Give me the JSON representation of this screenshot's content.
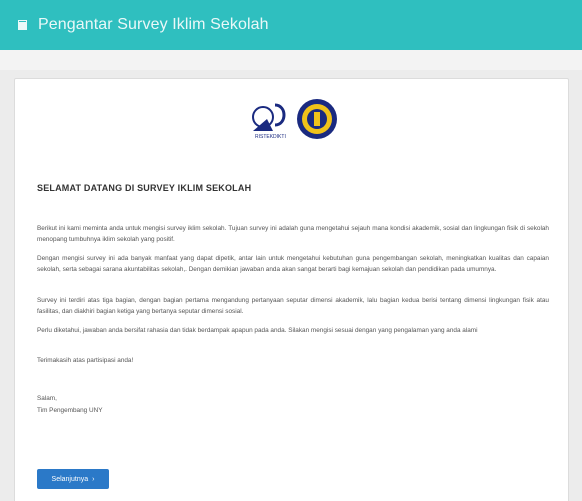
{
  "header": {
    "title": "Pengantar Survey Iklim Sekolah",
    "icon": "book-icon"
  },
  "logos": {
    "left": {
      "name": "ristekdikti-logo",
      "text": "RISTEKDIKTI"
    },
    "right": {
      "name": "uny-logo"
    }
  },
  "content": {
    "heading": "SELAMAT DATANG DI SURVEY IKLIM SEKOLAH",
    "paragraphs": [
      "Berikut ini kami meminta anda untuk mengisi survey iklim sekolah. Tujuan survey ini adalah guna mengetahui sejauh mana kondisi akademik, sosial dan lingkungan fisik di sekolah menopang tumbuhnya iklim sekolah yang positif.",
      "Dengan mengisi survey ini ada banyak manfaat yang dapat dipetik, antar lain untuk mengetahui kebutuhan guna pengembangan sekolah, meningkatkan kualitas dan capaian sekolah, serta sebagai sarana akuntabilitas sekolah,. Dengan demikian jawaban anda akan sangat berarti bagi kemajuan sekolah dan pendidikan pada umumnya.",
      "Survey ini terdiri atas tiga bagian, dengan bagian pertama mengandung pertanyaan seputar dimensi akademik, lalu bagian kedua berisi tentang dimensi lingkungan fisik atau fasilitas, dan diakhiri bagian ketiga yang bertanya seputar dimensi sosial.",
      "Perlu diketahui, jawaban anda bersifat rahasia dan tidak berdampak apapun pada anda. Silakan mengisi sesuai dengan yang pengalaman yang anda alami",
      "Terimakasih atas partisipasi anda!"
    ],
    "closing": "Salam,",
    "signature": "Tim Pengembang UNY"
  },
  "actions": {
    "next_label": "Selanjutnya",
    "next_icon": "chevron-right-icon"
  },
  "colors": {
    "header_bg": "#2fbfbf",
    "button_bg": "#2b79c8",
    "page_bg": "#ececec"
  }
}
